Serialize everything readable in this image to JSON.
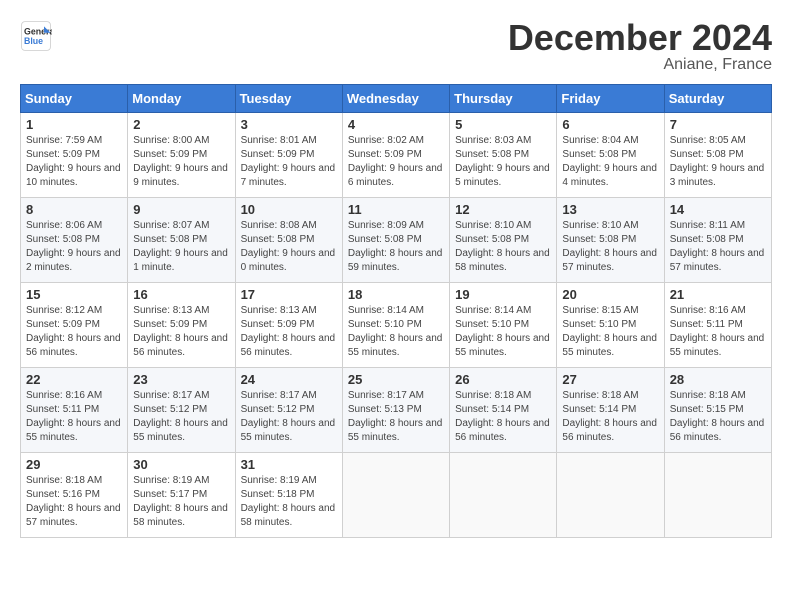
{
  "header": {
    "logo_line1": "General",
    "logo_line2": "Blue",
    "title": "December 2024",
    "subtitle": "Aniane, France"
  },
  "weekdays": [
    "Sunday",
    "Monday",
    "Tuesday",
    "Wednesday",
    "Thursday",
    "Friday",
    "Saturday"
  ],
  "weeks": [
    [
      {
        "day": "1",
        "sunrise": "Sunrise: 7:59 AM",
        "sunset": "Sunset: 5:09 PM",
        "daylight": "Daylight: 9 hours and 10 minutes."
      },
      {
        "day": "2",
        "sunrise": "Sunrise: 8:00 AM",
        "sunset": "Sunset: 5:09 PM",
        "daylight": "Daylight: 9 hours and 9 minutes."
      },
      {
        "day": "3",
        "sunrise": "Sunrise: 8:01 AM",
        "sunset": "Sunset: 5:09 PM",
        "daylight": "Daylight: 9 hours and 7 minutes."
      },
      {
        "day": "4",
        "sunrise": "Sunrise: 8:02 AM",
        "sunset": "Sunset: 5:09 PM",
        "daylight": "Daylight: 9 hours and 6 minutes."
      },
      {
        "day": "5",
        "sunrise": "Sunrise: 8:03 AM",
        "sunset": "Sunset: 5:08 PM",
        "daylight": "Daylight: 9 hours and 5 minutes."
      },
      {
        "day": "6",
        "sunrise": "Sunrise: 8:04 AM",
        "sunset": "Sunset: 5:08 PM",
        "daylight": "Daylight: 9 hours and 4 minutes."
      },
      {
        "day": "7",
        "sunrise": "Sunrise: 8:05 AM",
        "sunset": "Sunset: 5:08 PM",
        "daylight": "Daylight: 9 hours and 3 minutes."
      }
    ],
    [
      {
        "day": "8",
        "sunrise": "Sunrise: 8:06 AM",
        "sunset": "Sunset: 5:08 PM",
        "daylight": "Daylight: 9 hours and 2 minutes."
      },
      {
        "day": "9",
        "sunrise": "Sunrise: 8:07 AM",
        "sunset": "Sunset: 5:08 PM",
        "daylight": "Daylight: 9 hours and 1 minute."
      },
      {
        "day": "10",
        "sunrise": "Sunrise: 8:08 AM",
        "sunset": "Sunset: 5:08 PM",
        "daylight": "Daylight: 9 hours and 0 minutes."
      },
      {
        "day": "11",
        "sunrise": "Sunrise: 8:09 AM",
        "sunset": "Sunset: 5:08 PM",
        "daylight": "Daylight: 8 hours and 59 minutes."
      },
      {
        "day": "12",
        "sunrise": "Sunrise: 8:10 AM",
        "sunset": "Sunset: 5:08 PM",
        "daylight": "Daylight: 8 hours and 58 minutes."
      },
      {
        "day": "13",
        "sunrise": "Sunrise: 8:10 AM",
        "sunset": "Sunset: 5:08 PM",
        "daylight": "Daylight: 8 hours and 57 minutes."
      },
      {
        "day": "14",
        "sunrise": "Sunrise: 8:11 AM",
        "sunset": "Sunset: 5:08 PM",
        "daylight": "Daylight: 8 hours and 57 minutes."
      }
    ],
    [
      {
        "day": "15",
        "sunrise": "Sunrise: 8:12 AM",
        "sunset": "Sunset: 5:09 PM",
        "daylight": "Daylight: 8 hours and 56 minutes."
      },
      {
        "day": "16",
        "sunrise": "Sunrise: 8:13 AM",
        "sunset": "Sunset: 5:09 PM",
        "daylight": "Daylight: 8 hours and 56 minutes."
      },
      {
        "day": "17",
        "sunrise": "Sunrise: 8:13 AM",
        "sunset": "Sunset: 5:09 PM",
        "daylight": "Daylight: 8 hours and 56 minutes."
      },
      {
        "day": "18",
        "sunrise": "Sunrise: 8:14 AM",
        "sunset": "Sunset: 5:10 PM",
        "daylight": "Daylight: 8 hours and 55 minutes."
      },
      {
        "day": "19",
        "sunrise": "Sunrise: 8:14 AM",
        "sunset": "Sunset: 5:10 PM",
        "daylight": "Daylight: 8 hours and 55 minutes."
      },
      {
        "day": "20",
        "sunrise": "Sunrise: 8:15 AM",
        "sunset": "Sunset: 5:10 PM",
        "daylight": "Daylight: 8 hours and 55 minutes."
      },
      {
        "day": "21",
        "sunrise": "Sunrise: 8:16 AM",
        "sunset": "Sunset: 5:11 PM",
        "daylight": "Daylight: 8 hours and 55 minutes."
      }
    ],
    [
      {
        "day": "22",
        "sunrise": "Sunrise: 8:16 AM",
        "sunset": "Sunset: 5:11 PM",
        "daylight": "Daylight: 8 hours and 55 minutes."
      },
      {
        "day": "23",
        "sunrise": "Sunrise: 8:17 AM",
        "sunset": "Sunset: 5:12 PM",
        "daylight": "Daylight: 8 hours and 55 minutes."
      },
      {
        "day": "24",
        "sunrise": "Sunrise: 8:17 AM",
        "sunset": "Sunset: 5:12 PM",
        "daylight": "Daylight: 8 hours and 55 minutes."
      },
      {
        "day": "25",
        "sunrise": "Sunrise: 8:17 AM",
        "sunset": "Sunset: 5:13 PM",
        "daylight": "Daylight: 8 hours and 55 minutes."
      },
      {
        "day": "26",
        "sunrise": "Sunrise: 8:18 AM",
        "sunset": "Sunset: 5:14 PM",
        "daylight": "Daylight: 8 hours and 56 minutes."
      },
      {
        "day": "27",
        "sunrise": "Sunrise: 8:18 AM",
        "sunset": "Sunset: 5:14 PM",
        "daylight": "Daylight: 8 hours and 56 minutes."
      },
      {
        "day": "28",
        "sunrise": "Sunrise: 8:18 AM",
        "sunset": "Sunset: 5:15 PM",
        "daylight": "Daylight: 8 hours and 56 minutes."
      }
    ],
    [
      {
        "day": "29",
        "sunrise": "Sunrise: 8:18 AM",
        "sunset": "Sunset: 5:16 PM",
        "daylight": "Daylight: 8 hours and 57 minutes."
      },
      {
        "day": "30",
        "sunrise": "Sunrise: 8:19 AM",
        "sunset": "Sunset: 5:17 PM",
        "daylight": "Daylight: 8 hours and 58 minutes."
      },
      {
        "day": "31",
        "sunrise": "Sunrise: 8:19 AM",
        "sunset": "Sunset: 5:18 PM",
        "daylight": "Daylight: 8 hours and 58 minutes."
      },
      null,
      null,
      null,
      null
    ]
  ]
}
